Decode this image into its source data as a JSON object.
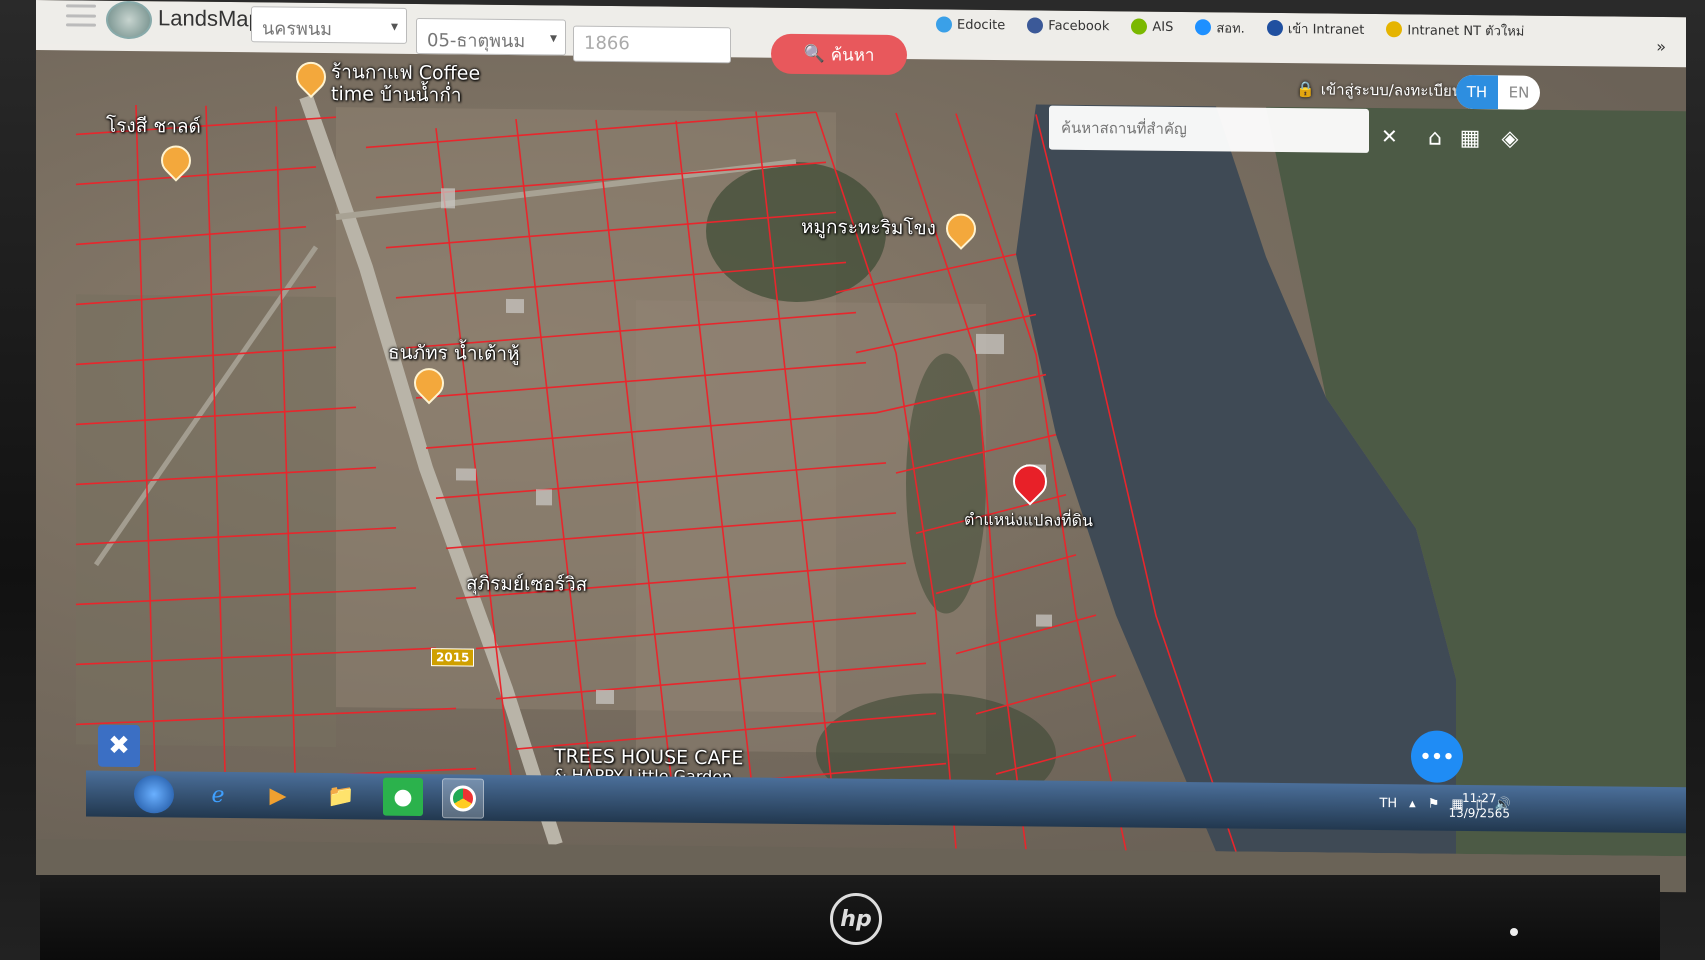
{
  "app": {
    "title": "LandsMaps",
    "province_value": "นครพนม",
    "district_value": "05-ธาตุพนม",
    "parcel_value": "1866",
    "search_label": "ค้นหา",
    "login_label": "เข้าสู่ระบบ/ลงทะเบียน",
    "lang_th": "TH",
    "lang_en": "EN",
    "place_search_placeholder": "ค้นหาสถานที่สำคัญ"
  },
  "bookmarks": [
    {
      "label": "Edocite",
      "color": "#3aa0e8"
    },
    {
      "label": "Facebook",
      "color": "#3b5998"
    },
    {
      "label": "AIS",
      "color": "#7ab800"
    },
    {
      "label": "สอท.",
      "color": "#1e90ff"
    },
    {
      "label": "เข้า Intranet",
      "color": "#2050a0"
    },
    {
      "label": "Intranet NT ตัวใหม่",
      "color": "#e5b400"
    }
  ],
  "bookmarks_more": "»",
  "map": {
    "pois": [
      {
        "label": "ร้านกาแฟ Coffee"
      },
      {
        "label": "time บ้านน้ำก่ำ"
      },
      {
        "label": "โรงสี ชาลด์"
      },
      {
        "label": "หมูกระทะริมโขง"
      },
      {
        "label": "ธนภัทร น้ำเต้าหู้"
      },
      {
        "label": "สุภิรมย์เซอร์วิส"
      },
      {
        "label": "TREES HOUSE CAFE"
      },
      {
        "label": "& HAPPY Little Garden"
      }
    ],
    "parcel_label": "ตำแหน่งแปลงที่ดิน",
    "road_number": "2015"
  },
  "taskbar": {
    "lang": "TH",
    "time": "11:27",
    "date": "13/9/2565"
  }
}
